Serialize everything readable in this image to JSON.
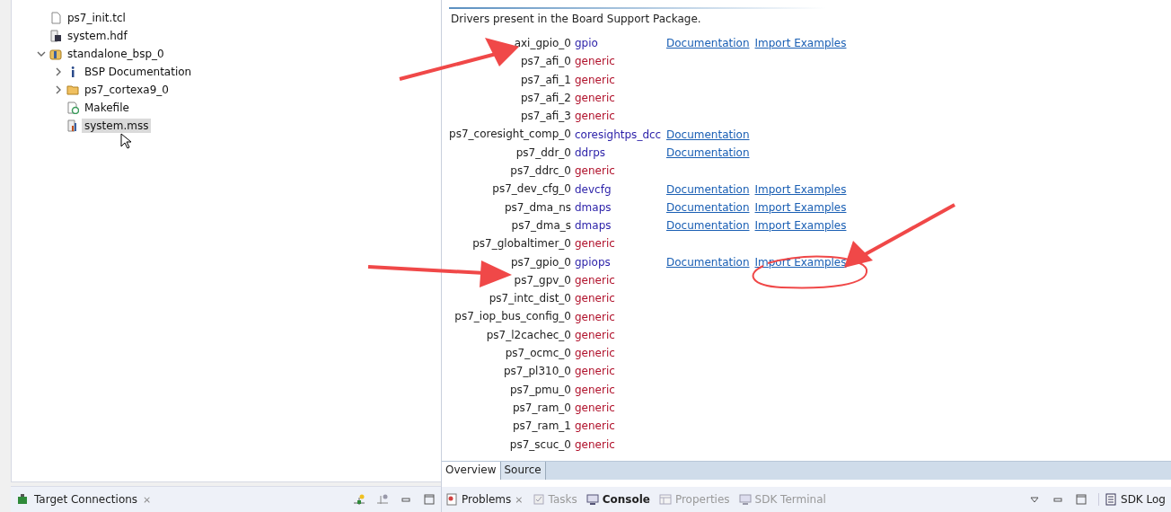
{
  "project_tree": [
    {
      "children": [
        {
          "label": "ps7_init.tcl",
          "kind": "file",
          "selected": false
        },
        {
          "label": "system.hdf",
          "kind": "hdf",
          "selected": false
        }
      ]
    },
    {
      "label": "standalone_bsp_0",
      "kind": "bsp",
      "expanded": true,
      "selected": false,
      "children": [
        {
          "label": "BSP Documentation",
          "kind": "info",
          "expanded": false,
          "selected": false
        },
        {
          "label": "ps7_cortexa9_0",
          "kind": "folder",
          "expanded": false,
          "selected": false
        },
        {
          "label": "Makefile",
          "kind": "makefile",
          "selected": false
        },
        {
          "label": "system.mss",
          "kind": "mss",
          "selected": true
        }
      ]
    }
  ],
  "left_view_tab": {
    "label": "Target Connections",
    "close": "⨯"
  },
  "editor": {
    "description": "Drivers present in the Board Support Package.",
    "drivers": [
      {
        "name": "axi_gpio_0",
        "driver": "gpio",
        "generic": false,
        "links": [
          "Documentation",
          "Import Examples"
        ]
      },
      {
        "name": "ps7_afi_0",
        "driver": "generic",
        "generic": true
      },
      {
        "name": "ps7_afi_1",
        "driver": "generic",
        "generic": true
      },
      {
        "name": "ps7_afi_2",
        "driver": "generic",
        "generic": true
      },
      {
        "name": "ps7_afi_3",
        "driver": "generic",
        "generic": true
      },
      {
        "name": "ps7_coresight_comp_0",
        "driver": "coresightps_dcc",
        "generic": false,
        "links": [
          "Documentation"
        ]
      },
      {
        "name": "ps7_ddr_0",
        "driver": "ddrps",
        "generic": false,
        "links": [
          "Documentation"
        ]
      },
      {
        "name": "ps7_ddrc_0",
        "driver": "generic",
        "generic": true
      },
      {
        "name": "ps7_dev_cfg_0",
        "driver": "devcfg",
        "generic": false,
        "links": [
          "Documentation",
          "Import Examples"
        ]
      },
      {
        "name": "ps7_dma_ns",
        "driver": "dmaps",
        "generic": false,
        "links": [
          "Documentation",
          "Import Examples"
        ]
      },
      {
        "name": "ps7_dma_s",
        "driver": "dmaps",
        "generic": false,
        "links": [
          "Documentation",
          "Import Examples"
        ]
      },
      {
        "name": "ps7_globaltimer_0",
        "driver": "generic",
        "generic": true
      },
      {
        "name": "ps7_gpio_0",
        "driver": "gpiops",
        "generic": false,
        "links": [
          "Documentation",
          "Import Examples"
        ]
      },
      {
        "name": "ps7_gpv_0",
        "driver": "generic",
        "generic": true
      },
      {
        "name": "ps7_intc_dist_0",
        "driver": "generic",
        "generic": true
      },
      {
        "name": "ps7_iop_bus_config_0",
        "driver": "generic",
        "generic": true
      },
      {
        "name": "ps7_l2cachec_0",
        "driver": "generic",
        "generic": true
      },
      {
        "name": "ps7_ocmc_0",
        "driver": "generic",
        "generic": true
      },
      {
        "name": "ps7_pl310_0",
        "driver": "generic",
        "generic": true
      },
      {
        "name": "ps7_pmu_0",
        "driver": "generic",
        "generic": true
      },
      {
        "name": "ps7_ram_0",
        "driver": "generic",
        "generic": true
      },
      {
        "name": "ps7_ram_1",
        "driver": "generic",
        "generic": true
      },
      {
        "name": "ps7_scuc_0",
        "driver": "generic",
        "generic": true
      }
    ],
    "tabs": [
      {
        "label": "Overview",
        "selected": true
      },
      {
        "label": "Source",
        "selected": false
      }
    ]
  },
  "bottom_tabs": [
    {
      "label": "Problems",
      "kind": "problems",
      "disabled": false,
      "close": "⨯"
    },
    {
      "label": "Tasks",
      "kind": "tasks",
      "disabled": true
    },
    {
      "label": "Console",
      "kind": "console",
      "disabled": false,
      "bold": true
    },
    {
      "label": "Properties",
      "kind": "properties",
      "disabled": true
    },
    {
      "label": "SDK Terminal",
      "kind": "terminal",
      "disabled": true
    }
  ],
  "side_tab": {
    "label": "SDK Log"
  }
}
